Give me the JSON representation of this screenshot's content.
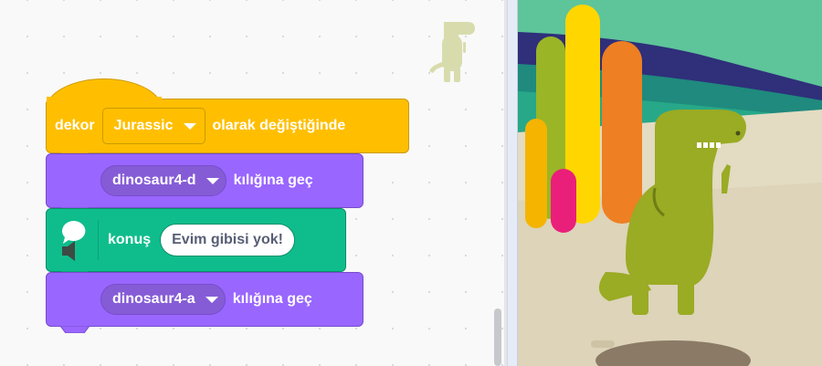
{
  "hat_block": {
    "prefix": "dekor",
    "dropdown_value": "Jurassic",
    "suffix": "olarak değiştiğinde"
  },
  "looks_block_1": {
    "dropdown_value": "dinosaur4-d",
    "suffix": "kılığına geç"
  },
  "speak_block": {
    "label": "konuş",
    "input_value": "Evim gibisi yok!"
  },
  "looks_block_2": {
    "dropdown_value": "dinosaur4-a",
    "suffix": "kılığına geç"
  },
  "colors": {
    "events": "#ffbf00",
    "looks": "#9966ff",
    "extension": "#0fbd8c"
  },
  "icons": {
    "speech": "speech-bubble-icon",
    "speaker": "speaker-icon",
    "dropdown": "chevron-down-icon"
  }
}
